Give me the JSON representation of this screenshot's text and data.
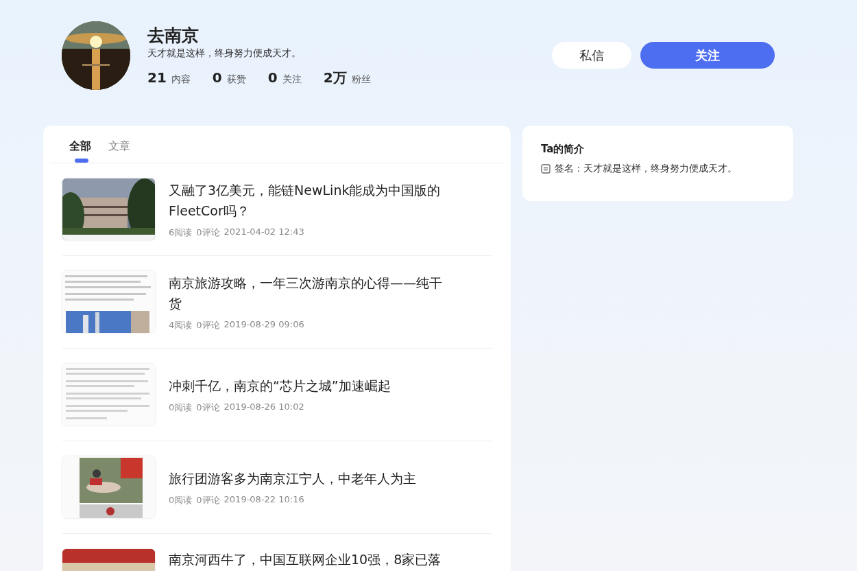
{
  "profile": {
    "name": "去南京",
    "bio": "天才就是这样，终身努力便成天才。",
    "stats": [
      {
        "value": "21",
        "label": "内容"
      },
      {
        "value": "0",
        "label": "获赞"
      },
      {
        "value": "0",
        "label": "关注"
      },
      {
        "value": "2万",
        "label": "粉丝"
      }
    ]
  },
  "actions": [
    {
      "kind": "secondary",
      "label": "私信"
    },
    {
      "kind": "primary",
      "label": "关注"
    }
  ],
  "tabs": [
    {
      "label": "全部",
      "selected": true
    },
    {
      "label": "文章",
      "selected": false
    }
  ],
  "articles": [
    {
      "title": "又融了3亿美元，能链NewLink能成为中国版的FleetCor吗？",
      "reads": "6阅读",
      "comments": "0评论",
      "time": "2021-04-02 12:43"
    },
    {
      "title": "南京旅游攻略，一年三次游南京的心得——纯干货",
      "reads": "4阅读",
      "comments": "0评论",
      "time": "2019-08-29 09:06"
    },
    {
      "title": "冲刺千亿，南京的“芯片之城”加速崛起",
      "reads": "0阅读",
      "comments": "0评论",
      "time": "2019-08-26 10:02"
    },
    {
      "title": "旅行团游客多为南京江宁人，中老年人为主",
      "reads": "0阅读",
      "comments": "0评论",
      "time": "2019-08-22 10:16"
    },
    {
      "title": "南京河西牛了，中国互联网企业10强，8家已落"
    }
  ],
  "intro": {
    "title": "Ta的简介",
    "signature": "签名：天才就是这样，终身努力便成天才。"
  }
}
